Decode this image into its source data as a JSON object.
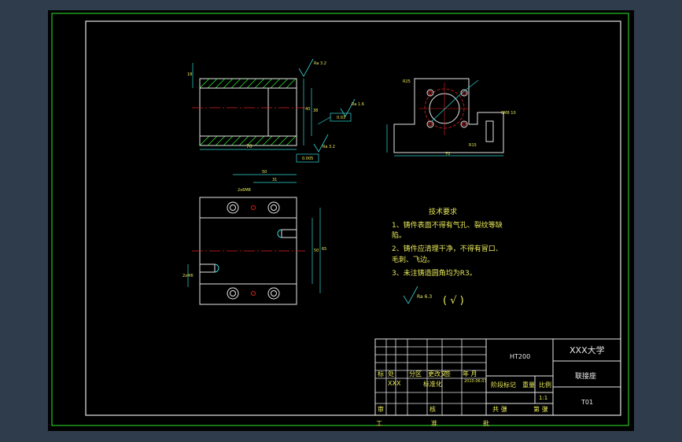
{
  "tech_requirements": {
    "title": "技术要求",
    "lines": [
      "1、铸件表面不得有气孔、裂纹等缺",
      "陷。",
      "2、铸件应清理干净，不得有冒口、",
      "毛刺、飞边。",
      "3、未注铸造圆角均为R3。"
    ],
    "roughness_symbol": "Ra 6.3",
    "roughness_paren": "(  √  )"
  },
  "dimensions": {
    "top_view_len": "70",
    "top_view_dia": "18",
    "top_view_h1": "40",
    "top_view_h2": "38",
    "rough1": "Ra 3.2",
    "rough2": "Ra 1.6",
    "rough3": "Ra 3.2",
    "tol1": "0.03",
    "tol2": "0.005",
    "side_len": "70",
    "side_r1": "R25",
    "side_thread": "6M8 10",
    "plan_w1": "50",
    "plan_w2": "31",
    "plan_hole": "2x6M8",
    "plan_h": "65",
    "plan_h2": "50",
    "plan_left": "2xM6"
  },
  "title_block": {
    "material": "HT200",
    "school": "XXX大学",
    "part_name": "联接座",
    "drawing_no": "T01",
    "row1": [
      "标",
      "处",
      "分区",
      "更改文",
      "签",
      "年 月",
      "日"
    ],
    "designer": "XXX",
    "std_label": "标准化",
    "date": "2010.06.07",
    "stage_label": "阶段标记",
    "weight_label": "重量",
    "scale_label": "比例",
    "scale_val": "1:1",
    "sheets": "共 张",
    "sheet_label": "第 张",
    "approve_row": [
      "审",
      "核",
      "批"
    ],
    "process_row": [
      "工",
      "艺",
      "准"
    ],
    "count_total": "3",
    "count_sheet": "2"
  }
}
